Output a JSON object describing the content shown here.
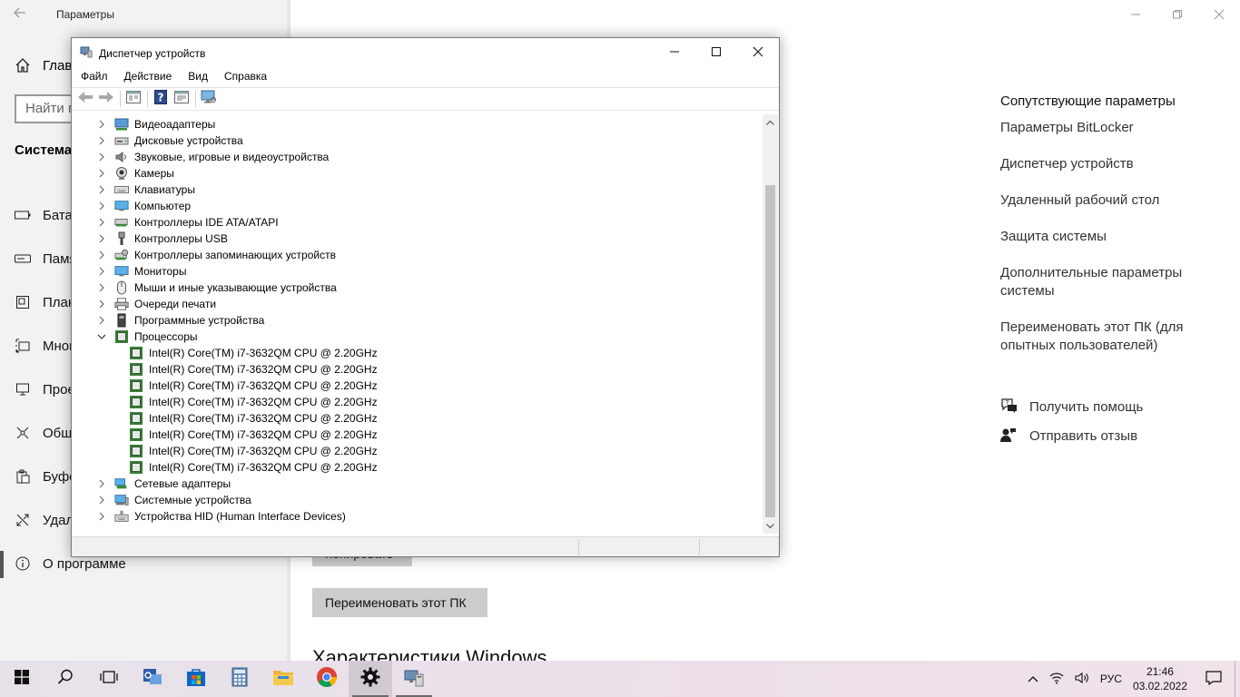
{
  "settings": {
    "title": "Параметры",
    "home_label": "Главная",
    "search_placeholder": "Найти параметр",
    "section_title": "Система",
    "nav_items": [
      {
        "label": "Батарея",
        "icon": "battery-icon"
      },
      {
        "label": "Память",
        "icon": "storage-icon"
      },
      {
        "label": "Планшет",
        "icon": "tablet-icon"
      },
      {
        "label": "Многозадачность",
        "icon": "multitasking-icon"
      },
      {
        "label": "Проецирование на этот компьютер",
        "icon": "projecting-icon"
      },
      {
        "label": "Общие возможности",
        "icon": "shared-experiences-icon"
      },
      {
        "label": "Буфер обмена",
        "icon": "clipboard-icon"
      },
      {
        "label": "Удаленный рабочий стол",
        "icon": "remote-desktop-icon"
      },
      {
        "label": "О программе",
        "icon": "info-icon"
      }
    ],
    "related_title": "Сопутствующие параметры",
    "related_links": [
      "Параметры BitLocker",
      "Диспетчер устройств",
      "Удаленный рабочий стол",
      "Защита системы",
      "Дополнительные параметры системы",
      "Переименовать этот ПК (для опытных пользователей)"
    ],
    "help_links": [
      {
        "label": "Получить помощь",
        "icon": "help-chat-icon"
      },
      {
        "label": "Отправить отзыв",
        "icon": "feedback-icon"
      }
    ],
    "copy_button": "Копировать",
    "rename_button": "Переименовать этот ПК",
    "windows_spec_heading": "Характеристики Windows"
  },
  "devmgr": {
    "title": "Диспетчер устройств",
    "menu": [
      "Файл",
      "Действие",
      "Вид",
      "Справка"
    ],
    "tree": [
      {
        "label": "Видеоадаптеры",
        "icon": "display-adapter-icon",
        "expanded": false
      },
      {
        "label": "Дисковые устройства",
        "icon": "disk-drive-icon",
        "expanded": false
      },
      {
        "label": "Звуковые, игровые и видеоустройства",
        "icon": "sound-icon",
        "expanded": false
      },
      {
        "label": "Камеры",
        "icon": "camera-icon",
        "expanded": false
      },
      {
        "label": "Клавиатуры",
        "icon": "keyboard-icon",
        "expanded": false
      },
      {
        "label": "Компьютер",
        "icon": "computer-icon",
        "expanded": false
      },
      {
        "label": "Контроллеры IDE ATA/ATAPI",
        "icon": "ide-controller-icon",
        "expanded": false
      },
      {
        "label": "Контроллеры USB",
        "icon": "usb-icon",
        "expanded": false
      },
      {
        "label": "Контроллеры запоминающих устройств",
        "icon": "storage-controller-icon",
        "expanded": false
      },
      {
        "label": "Мониторы",
        "icon": "monitor-icon",
        "expanded": false
      },
      {
        "label": "Мыши и иные указывающие устройства",
        "icon": "mouse-icon",
        "expanded": false
      },
      {
        "label": "Очереди печати",
        "icon": "printer-icon",
        "expanded": false
      },
      {
        "label": "Программные устройства",
        "icon": "software-device-icon",
        "expanded": false
      },
      {
        "label": "Процессоры",
        "icon": "processor-icon",
        "expanded": true,
        "children": [
          "Intel(R) Core(TM) i7-3632QM CPU @ 2.20GHz",
          "Intel(R) Core(TM) i7-3632QM CPU @ 2.20GHz",
          "Intel(R) Core(TM) i7-3632QM CPU @ 2.20GHz",
          "Intel(R) Core(TM) i7-3632QM CPU @ 2.20GHz",
          "Intel(R) Core(TM) i7-3632QM CPU @ 2.20GHz",
          "Intel(R) Core(TM) i7-3632QM CPU @ 2.20GHz",
          "Intel(R) Core(TM) i7-3632QM CPU @ 2.20GHz",
          "Intel(R) Core(TM) i7-3632QM CPU @ 2.20GHz"
        ]
      },
      {
        "label": "Сетевые адаптеры",
        "icon": "network-adapter-icon",
        "expanded": false
      },
      {
        "label": "Системные устройства",
        "icon": "system-device-icon",
        "expanded": false
      },
      {
        "label": "Устройства HID (Human Interface Devices)",
        "icon": "hid-icon",
        "expanded": false
      }
    ]
  },
  "taskbar": {
    "apps": [
      "start-icon",
      "search-icon",
      "task-view-icon",
      "outlook-icon",
      "store-icon",
      "calculator-icon",
      "file-explorer-icon",
      "chrome-icon",
      "settings-icon",
      "device-manager-icon"
    ],
    "language": "РУС",
    "time": "21:46",
    "date": "03.02.2022"
  },
  "colors": {
    "accent": "#0078d7",
    "sidebar_bg": "#f2f2f2",
    "processor_green": "#3a7d3a"
  }
}
